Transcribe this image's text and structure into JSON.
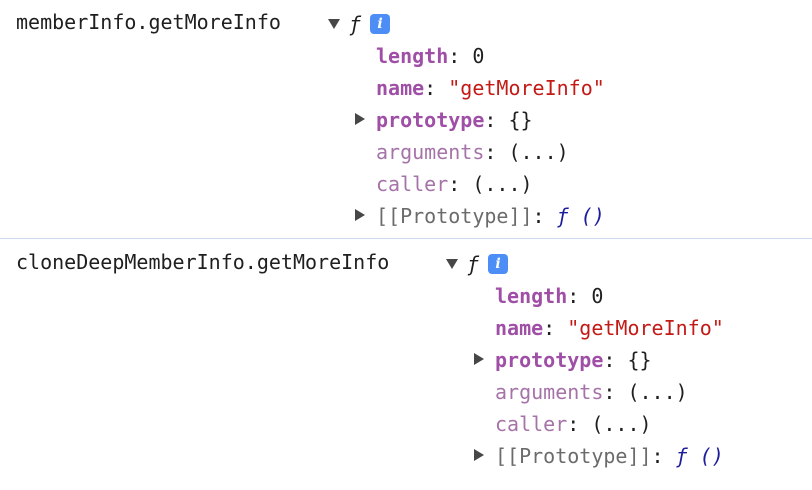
{
  "entries": [
    {
      "expression": "memberInfo.getMoreInfo",
      "func_marker": "ƒ",
      "info_icon": "i",
      "properties": [
        {
          "key": "length",
          "sep": ": ",
          "value": "0"
        },
        {
          "key": "name",
          "sep": ": ",
          "value": "\"getMoreInfo\""
        },
        {
          "key": "prototype",
          "sep": ": ",
          "value": "{}"
        },
        {
          "key": "arguments",
          "sep": ": ",
          "value": "(...)"
        },
        {
          "key": "caller",
          "sep": ": ",
          "value": "(...)"
        },
        {
          "key": "[[Prototype]]",
          "sep": ": ",
          "value": "ƒ ()"
        }
      ]
    },
    {
      "expression": "cloneDeepMemberInfo.getMoreInfo",
      "func_marker": "ƒ",
      "info_icon": "i",
      "properties": [
        {
          "key": "length",
          "sep": ": ",
          "value": "0"
        },
        {
          "key": "name",
          "sep": ": ",
          "value": "\"getMoreInfo\""
        },
        {
          "key": "prototype",
          "sep": ": ",
          "value": "{}"
        },
        {
          "key": "arguments",
          "sep": ": ",
          "value": "(...)"
        },
        {
          "key": "caller",
          "sep": ": ",
          "value": "(...)"
        },
        {
          "key": "[[Prototype]]",
          "sep": ": ",
          "value": "ƒ ()"
        }
      ]
    }
  ],
  "colors": {
    "own_key": "#9f4fa6",
    "accessor_key": "#a673a9",
    "internal_key": "#6b6b6b",
    "string_value": "#c41a16",
    "function_ref": "#1d1d9c",
    "info_badge": "#4c8df6",
    "divider": "#cfdcf0"
  },
  "icons": [
    "expand-triangle-down-icon",
    "collapse-triangle-right-icon",
    "info-icon"
  ]
}
